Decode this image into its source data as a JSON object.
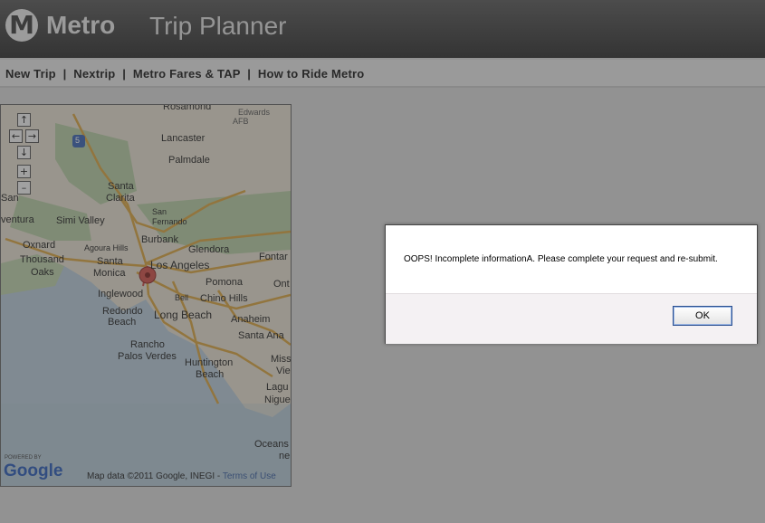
{
  "header": {
    "logo_letter": "M",
    "logo_text": "Metro",
    "title": "Trip Planner"
  },
  "nav": {
    "items": [
      "New Trip",
      "Nextrip",
      "Metro Fares & TAP",
      "How to Ride Metro"
    ],
    "separator": "|"
  },
  "map": {
    "controls": {
      "up": "↑",
      "left": "←",
      "right": "→",
      "down": "↓",
      "zoom_in": "+",
      "zoom_out": "–"
    },
    "highway_shield": "5",
    "cities": {
      "rosamond": "Rosamond",
      "edwards": "Edwards",
      "afb": "AFB",
      "lancaster": "Lancaster",
      "palmdale": "Palmdale",
      "santa": "Santa",
      "clarita": "Clarita",
      "san": "San",
      "aventura": "ventura",
      "simi_valley": "Simi Valley",
      "san2": "San",
      "fernando": "Fernando",
      "burbank": "Burbank",
      "oxnard": "Oxnard",
      "agoura_hills": "Agoura Hills",
      "glendora": "Glendora",
      "thousand": "Thousand",
      "oaks": "Oaks",
      "santa2": "Santa",
      "monica": "Monica",
      "los_angeles": "Los Angeles",
      "fontana": "Fontar",
      "pomona": "Pomona",
      "ont": "Ont",
      "inglewood": "Inglewood",
      "bell": "Bell",
      "chino_hills": "Chino Hills",
      "redondo": "Redondo",
      "beach": "Beach",
      "long_beach": "Long Beach",
      "anaheim": "Anaheim",
      "rancho": "Rancho",
      "palos_verdes": "Palos Verdes",
      "santa_ana": "Santa Ana",
      "huntington": "Huntington",
      "beach2": "Beach",
      "miss": "Miss",
      "vie": "Vie",
      "lagu": "Lagu",
      "nigue": "Nigue",
      "oceans": "Oceans",
      "ne": "ne"
    },
    "powered_by": "POWERED BY",
    "google": "Google",
    "attribution": "Map data ©2011 Google, INEGI - ",
    "terms": "Terms of Use"
  },
  "dialog": {
    "message": "OOPS! Incomplete informationA. Please complete your request and re-submit.",
    "ok_label": "OK"
  }
}
